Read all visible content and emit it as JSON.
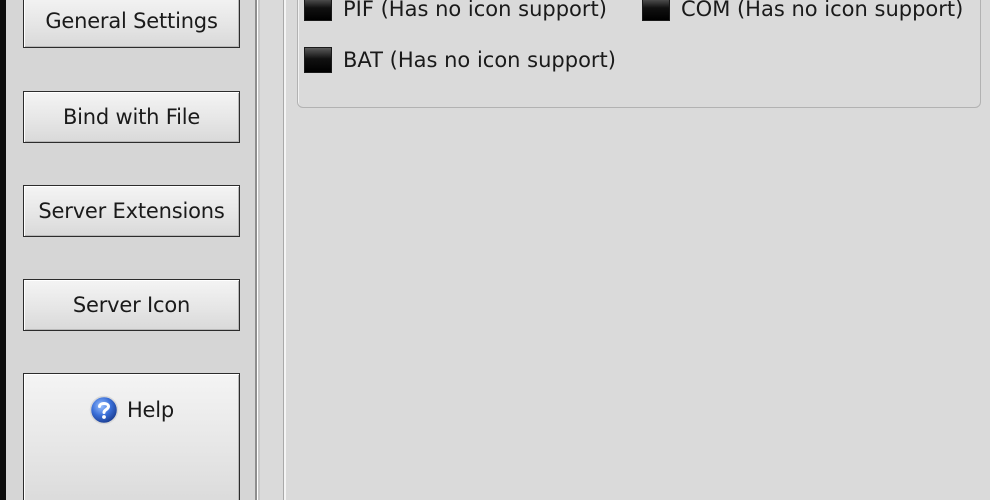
{
  "sidebar": {
    "buttons": [
      {
        "label": "General Settings"
      },
      {
        "label": "Bind with File"
      },
      {
        "label": "Server Extensions"
      },
      {
        "label": "Server Icon"
      },
      {
        "label": "Help",
        "icon": "help-question-icon"
      }
    ]
  },
  "main": {
    "extensions": [
      {
        "label": "PIF (Has no icon support)",
        "checked": false
      },
      {
        "label": "COM (Has no icon support)",
        "checked": false
      },
      {
        "label": "BAT (Has no icon support)",
        "checked": false
      }
    ]
  },
  "colors": {
    "background": "#dadada",
    "button_border": "#2c2c2c",
    "help_icon": "#2a5bb8"
  }
}
